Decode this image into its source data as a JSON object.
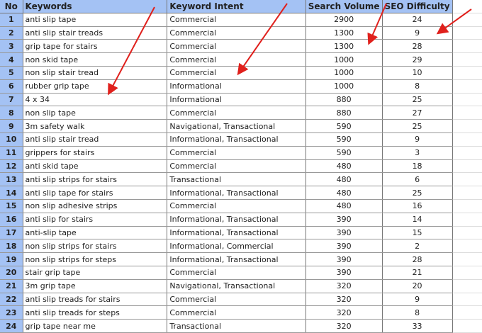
{
  "headers": {
    "no": "No",
    "keywords": "Keywords",
    "intent": "Keyword Intent",
    "volume": "Search Volume",
    "difficulty": "SEO Difficulty"
  },
  "rows": [
    {
      "no": "1",
      "kw": "anti slip tape",
      "intent": "Commercial",
      "vol": "2900",
      "kd": "24"
    },
    {
      "no": "2",
      "kw": "anti slip stair treads",
      "intent": "Commercial",
      "vol": "1300",
      "kd": "9"
    },
    {
      "no": "3",
      "kw": "grip tape for stairs",
      "intent": "Commercial",
      "vol": "1300",
      "kd": "28"
    },
    {
      "no": "4",
      "kw": "non skid tape",
      "intent": "Commercial",
      "vol": "1000",
      "kd": "29"
    },
    {
      "no": "5",
      "kw": "non slip stair tread",
      "intent": "Commercial",
      "vol": "1000",
      "kd": "10"
    },
    {
      "no": "6",
      "kw": "rubber grip tape",
      "intent": "Informational",
      "vol": "1000",
      "kd": "8"
    },
    {
      "no": "7",
      "kw": "4 x 34",
      "intent": "Informational",
      "vol": "880",
      "kd": "25"
    },
    {
      "no": "8",
      "kw": "non slip tape",
      "intent": "Commercial",
      "vol": "880",
      "kd": "27"
    },
    {
      "no": "9",
      "kw": "3m safety walk",
      "intent": "Navigational, Transactional",
      "vol": "590",
      "kd": "25"
    },
    {
      "no": "10",
      "kw": "anti slip stair tread",
      "intent": "Informational, Transactional",
      "vol": "590",
      "kd": "9"
    },
    {
      "no": "11",
      "kw": "grippers for stairs",
      "intent": "Commercial",
      "vol": "590",
      "kd": "3"
    },
    {
      "no": "12",
      "kw": "anti skid tape",
      "intent": "Commercial",
      "vol": "480",
      "kd": "18"
    },
    {
      "no": "13",
      "kw": "anti slip strips for stairs",
      "intent": "Transactional",
      "vol": "480",
      "kd": "6"
    },
    {
      "no": "14",
      "kw": "anti slip tape for stairs",
      "intent": "Informational, Transactional",
      "vol": "480",
      "kd": "25"
    },
    {
      "no": "15",
      "kw": "non slip adhesive strips",
      "intent": "Commercial",
      "vol": "480",
      "kd": "16"
    },
    {
      "no": "16",
      "kw": "anti slip for stairs",
      "intent": "Informational, Transactional",
      "vol": "390",
      "kd": "14"
    },
    {
      "no": "17",
      "kw": "anti-slip tape",
      "intent": "Informational, Transactional",
      "vol": "390",
      "kd": "15"
    },
    {
      "no": "18",
      "kw": "non slip strips for stairs",
      "intent": "Informational, Commercial",
      "vol": "390",
      "kd": "2"
    },
    {
      "no": "19",
      "kw": "non slip strips for steps",
      "intent": "Informational, Transactional",
      "vol": "390",
      "kd": "28"
    },
    {
      "no": "20",
      "kw": "stair grip tape",
      "intent": "Commercial",
      "vol": "390",
      "kd": "21"
    },
    {
      "no": "21",
      "kw": "3m grip tape",
      "intent": "Navigational, Transactional",
      "vol": "320",
      "kd": "20"
    },
    {
      "no": "22",
      "kw": "anti slip treads for stairs",
      "intent": "Commercial",
      "vol": "320",
      "kd": "9"
    },
    {
      "no": "23",
      "kw": "anti slip treads for steps",
      "intent": "Commercial",
      "vol": "320",
      "kd": "8"
    },
    {
      "no": "24",
      "kw": "grip tape near me",
      "intent": "Transactional",
      "vol": "320",
      "kd": "33"
    }
  ],
  "arrow_color": "#e0201c"
}
